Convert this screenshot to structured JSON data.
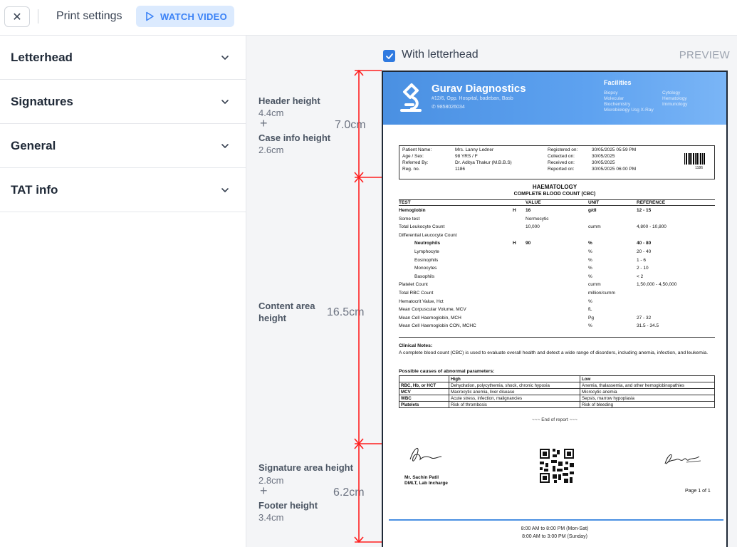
{
  "topbar": {
    "close_label": "✕",
    "title": "Print settings",
    "watch_video_label": "WATCH VIDEO",
    "watch_video_color": "#3b82f6"
  },
  "sidebar": {
    "items": [
      {
        "label": "Letterhead"
      },
      {
        "label": "Signatures"
      },
      {
        "label": "General"
      },
      {
        "label": "TAT info"
      }
    ]
  },
  "preview": {
    "with_letterhead_label": "With letterhead",
    "with_letterhead_checked": true,
    "preview_label": "PREVIEW",
    "accent_color": "#ff1f1f"
  },
  "measurements": {
    "header_label": "Header height",
    "header_value": "4.4cm",
    "case_info_label": "Case info height",
    "case_info_value": "2.6cm",
    "top_total": "7.0cm",
    "plus": "+",
    "content_label_1": "Content area",
    "content_label_2": "height",
    "content_total": "16.5cm",
    "signature_label": "Signature area height",
    "signature_value": "2.8cm",
    "footer_label": "Footer height",
    "footer_value": "3.4cm",
    "bottom_total": "6.2cm"
  },
  "report": {
    "lab_name": "Gurav Diagnostics",
    "lab_address": "#12/6, Opp. Hospital, badeban, Basb",
    "lab_phone": "✆ 9858026034",
    "facilities_title": "Facilities",
    "facilities": [
      "Biopsy",
      "Cytology",
      "Molecular",
      "Hematology",
      "Biochemistry",
      "Immunology",
      "Microbiology Usg X-Ray",
      ""
    ],
    "header_color": "#4a90e2",
    "case": {
      "patient_name_label": "Patient Name:",
      "patient_name": "Mrs. Lanny Ledner",
      "age_sex_label": "Age / Sex:",
      "age_sex": "98 YRS / F",
      "referred_label": "Referred By:",
      "referred": "Dr. Aditya Thakur (M.B.B.S)",
      "reg_label": "Reg. no.",
      "reg": "1186",
      "registered_label": "Registered on:",
      "registered": "30/05/2025  05:59 PM",
      "collected_label": "Collected on:",
      "collected": "30/05/2025",
      "received_label": "Received on:",
      "received": "30/05/2025",
      "reported_label": "Reported on:",
      "reported": "30/05/2025  06:00 PM",
      "barcode_number": "1186"
    },
    "section_title": "HAEMATOLOGY",
    "subsection_title": "COMPLETE BLOOD COUNT (CBC)",
    "columns": {
      "test": "TEST",
      "value": "VALUE",
      "unit": "UNIT",
      "reference": "REFERENCE"
    },
    "rows": [
      {
        "test": "Hemoglobin",
        "flag": "H",
        "value": "16",
        "unit": "g/dl",
        "ref": "12 - 15",
        "bold": true,
        "indent": false
      },
      {
        "test": "Some test",
        "flag": "",
        "value": "Normocytic",
        "unit": "",
        "ref": "",
        "bold": false,
        "indent": false
      },
      {
        "test": "Total Leukocyte Count",
        "flag": "",
        "value": "10,000",
        "unit": "cumm",
        "ref": "4,800 - 10,800",
        "bold": false,
        "indent": false
      },
      {
        "test": "Differential Leucocyte Count",
        "flag": "",
        "value": "",
        "unit": "",
        "ref": "",
        "bold": false,
        "indent": false
      },
      {
        "test": "Neutrophils",
        "flag": "H",
        "value": "90",
        "unit": "%",
        "ref": "40 - 80",
        "bold": true,
        "indent": true
      },
      {
        "test": "Lymphocyte",
        "flag": "",
        "value": "",
        "unit": "%",
        "ref": "20 - 40",
        "bold": false,
        "indent": true
      },
      {
        "test": "Eosinophils",
        "flag": "",
        "value": "",
        "unit": "%",
        "ref": "1 - 6",
        "bold": false,
        "indent": true
      },
      {
        "test": "Monocytes",
        "flag": "",
        "value": "",
        "unit": "%",
        "ref": "2 - 10",
        "bold": false,
        "indent": true
      },
      {
        "test": "Basophils",
        "flag": "",
        "value": "",
        "unit": "%",
        "ref": "< 2",
        "bold": false,
        "indent": true
      },
      {
        "test": "Platelet Count",
        "flag": "",
        "value": "",
        "unit": "cumm",
        "ref": "1,50,000 - 4,50,000",
        "bold": false,
        "indent": false
      },
      {
        "test": "Total RBC Count",
        "flag": "",
        "value": "",
        "unit": "million/cumm",
        "ref": "",
        "bold": false,
        "indent": false
      },
      {
        "test": "Hematocrit Value, Hct",
        "flag": "",
        "value": "",
        "unit": "%",
        "ref": "",
        "bold": false,
        "indent": false
      },
      {
        "test": "Mean Corpuscular Volume, MCV",
        "flag": "",
        "value": "",
        "unit": "fL",
        "ref": "",
        "bold": false,
        "indent": false
      },
      {
        "test": "Mean Cell Haemoglobin, MCH",
        "flag": "",
        "value": "",
        "unit": "Pg",
        "ref": "27 - 32",
        "bold": false,
        "indent": false
      },
      {
        "test": "Mean Cell Haemoglobin CON, MCHC",
        "flag": "",
        "value": "",
        "unit": "%",
        "ref": "31.5 - 34.5",
        "bold": false,
        "indent": false
      }
    ],
    "notes_title": "Clinical Notes:",
    "notes_text": "A complete blood count (CBC) is used to evaluate overall health and detect a wide range of disorders, including anemia, infection, and leukemia.",
    "causes_title": "Possible causes of abnormal parameters:",
    "causes_headers": [
      "",
      "High",
      "Low"
    ],
    "causes": [
      [
        "RBC, Hb, or HCT",
        "Dehydration, polycythemia, shock, chronic hypoxia",
        "Anemia, thalassemia, and other hemoglobinopathies"
      ],
      [
        "MCV",
        "Macrocytic anemia, liver disease",
        "Microcytic anemia"
      ],
      [
        "WBC",
        "Acute stress, infection, malignancies",
        "Sepsis, marrow hypoplasia"
      ],
      [
        "Platelets",
        "Risk of thrombosis",
        "Risk of bleeding"
      ]
    ],
    "end_of_report": "~~~ End of report ~~~",
    "signatory_name": "Mr. Sachin Patil",
    "signatory_title": "DMLT, Lab Incharge",
    "page_number": "Page 1 of 1",
    "footer_line_1": "8:00 AM to 8:00 PM (Mon-Sat)",
    "footer_line_2": "8:00 AM to 3:00 PM (Sunday)"
  }
}
